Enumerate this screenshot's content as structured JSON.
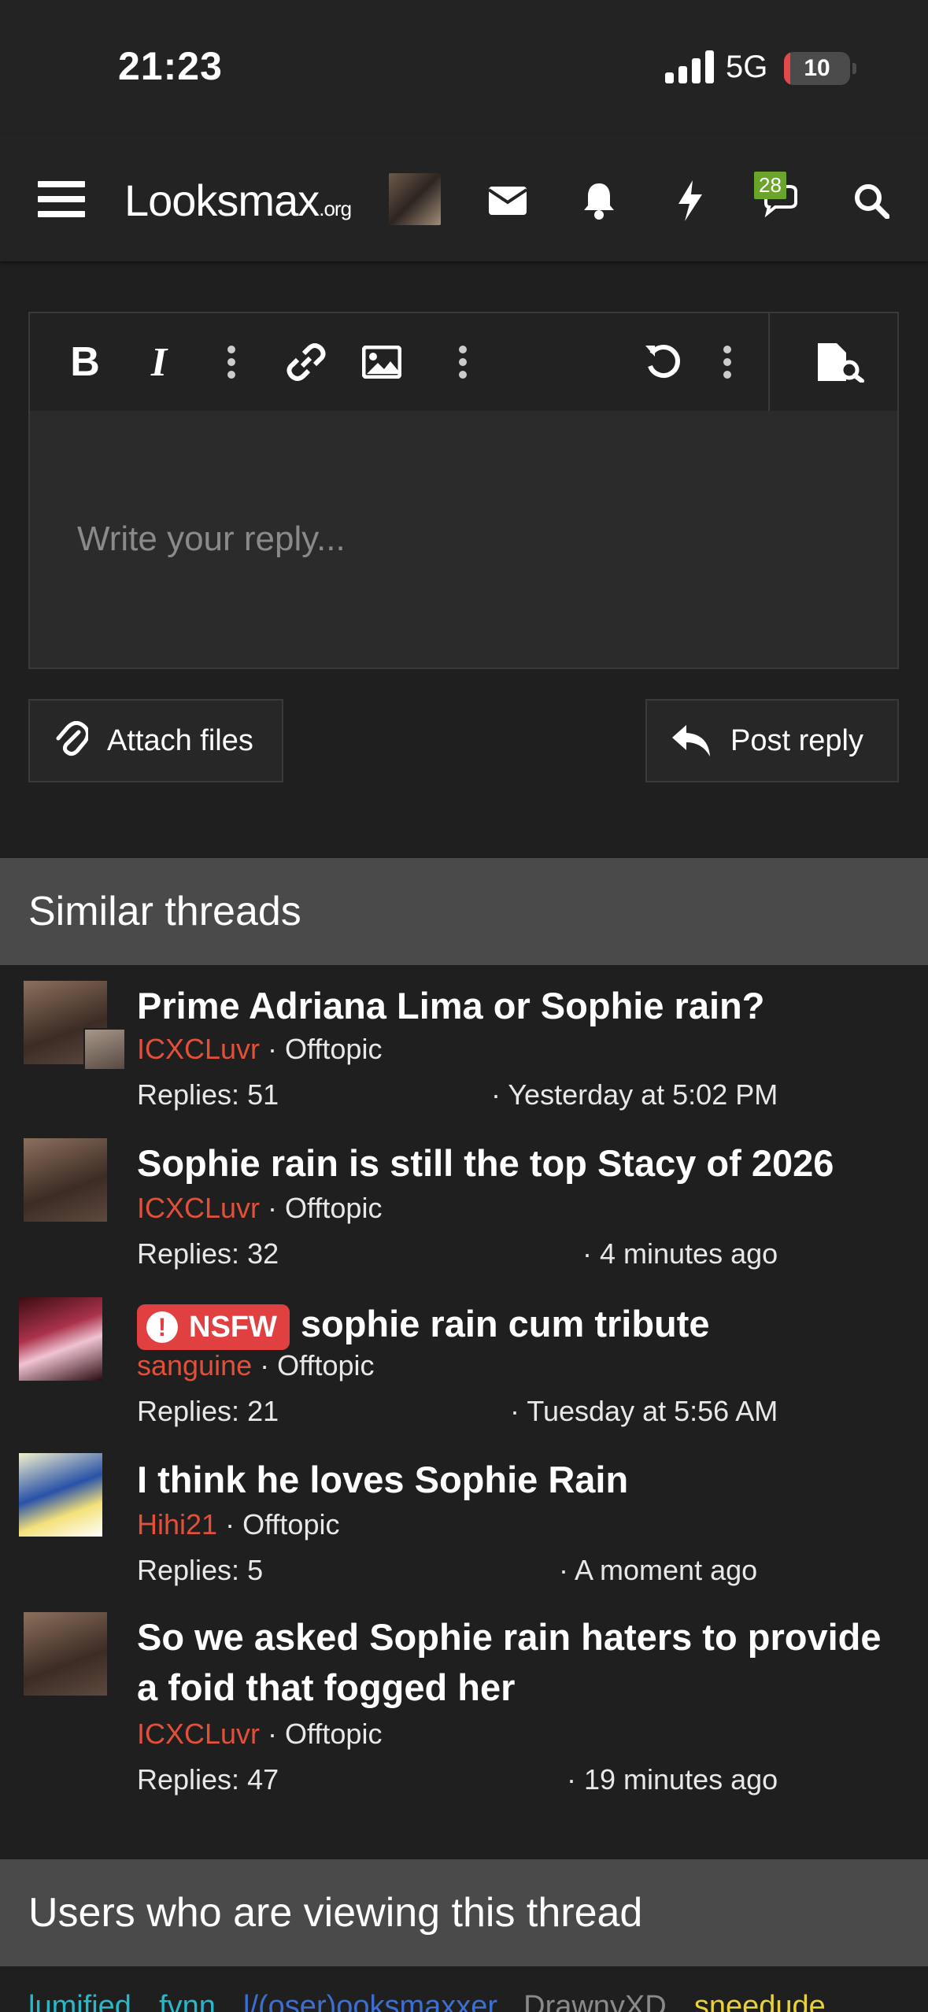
{
  "status_bar": {
    "time": "21:23",
    "network": "5G",
    "battery": "10",
    "battery_level": 0.1
  },
  "nav": {
    "logo_main": "Looksmax",
    "logo_suffix": ".org",
    "chat_badge": "28",
    "icons": [
      "menu-icon",
      "envelope-icon",
      "bell-icon",
      "bolt-icon",
      "chat-icon",
      "search-icon"
    ]
  },
  "editor": {
    "placeholder": "Write your reply...",
    "toolbar": [
      "bold-icon",
      "italic-icon",
      "more-icon",
      "link-icon",
      "image-icon",
      "more-icon",
      "undo-icon",
      "more-icon",
      "preview-icon"
    ]
  },
  "actions": {
    "attach_label": "Attach files",
    "post_label": "Post reply"
  },
  "similar": {
    "heading": "Similar threads",
    "threads": [
      {
        "title": "Prime Adriana Lima or Sophie rain?",
        "author": "ICXCLuvr",
        "forum": "Offtopic",
        "replies": "Replies: 51",
        "time": "· Yesterday at 5:02 PM"
      },
      {
        "title": "Sophie rain is still the top Stacy of 2026",
        "author": "ICXCLuvr",
        "forum": "Offtopic",
        "replies": "Replies: 32",
        "time": "· 4 minutes ago"
      },
      {
        "prefix": "NSFW",
        "title": "sophie rain cum tribute",
        "author": "sanguine",
        "forum": "Offtopic",
        "replies": "Replies: 21",
        "time": "· Tuesday at 5:56 AM"
      },
      {
        "title": "I think he loves Sophie Rain",
        "author": "Hihi21",
        "forum": "Offtopic",
        "replies": "Replies: 5",
        "time": "· A moment ago"
      },
      {
        "title": "So we asked Sophie rain haters to provide a foid that fogged her",
        "author": "ICXCLuvr",
        "forum": "Offtopic",
        "replies": "Replies: 47",
        "time": "· 19 minutes ago"
      }
    ],
    "separator": " · "
  },
  "viewing": {
    "heading": "Users who are viewing this thread",
    "users": [
      {
        "name": "lumified,",
        "color": "#2ab7c9"
      },
      {
        "name": "fvnn,",
        "color": "#2ab7c9"
      },
      {
        "name": "l/(oser)ooksmaxxer,",
        "color": "#3d6fd1"
      },
      {
        "name": "DrawnyXD,",
        "color": "#8a8a8a"
      },
      {
        "name": "sneedude",
        "color": "#e8d23a"
      }
    ]
  },
  "colors": {
    "author": "#e2503a",
    "badge": "#6aa42b",
    "nsfw": "#e14040"
  }
}
